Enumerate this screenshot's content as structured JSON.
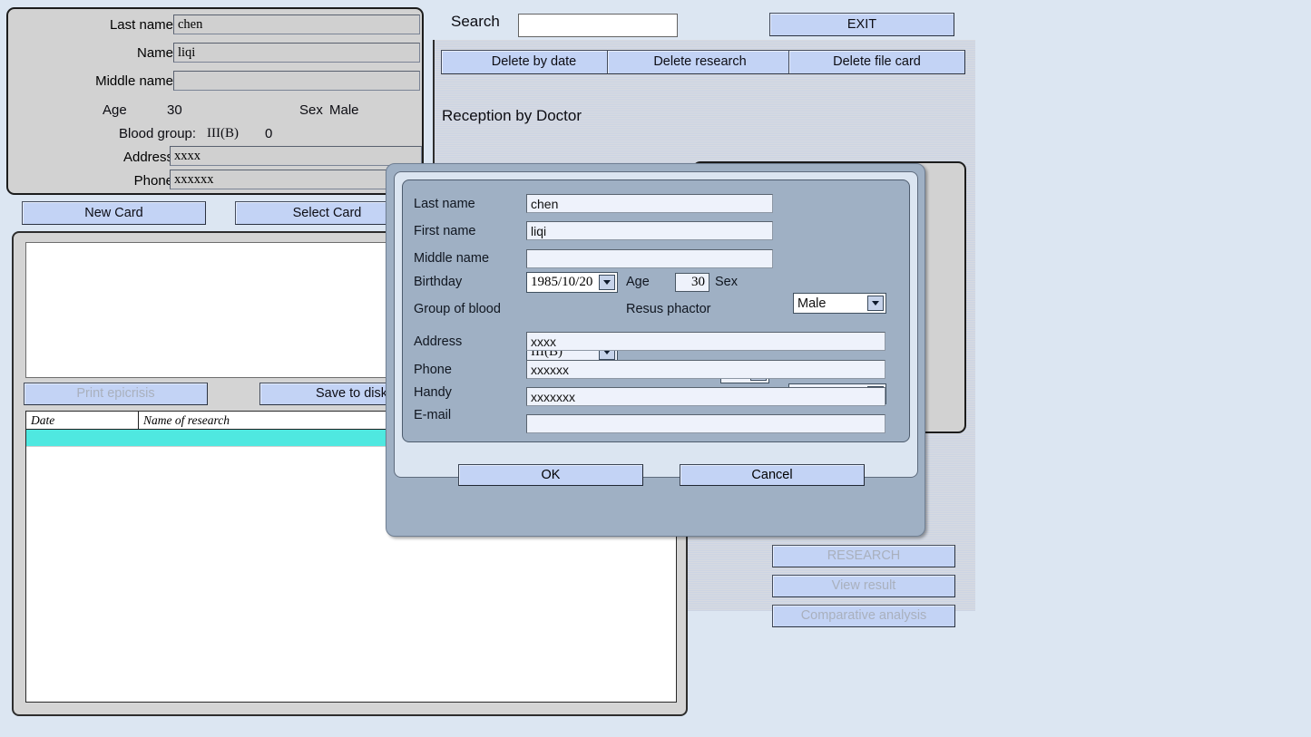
{
  "app": {
    "background_color": "#dce6f2",
    "accent_button_color": "#c3d3f5",
    "selection_color": "#4fe8e0"
  },
  "card_panel": {
    "rows": [
      {
        "label": "Last name",
        "value": "chen"
      },
      {
        "label": "Name",
        "value": "liqi"
      },
      {
        "label": "Middle name",
        "value": ""
      }
    ],
    "age_label": "Age",
    "age_value": "30",
    "sex_label": "Sex",
    "sex_value": "Male",
    "blood_group_label": "Blood group:",
    "blood_group_value": "III(B)",
    "resus_value": "0",
    "address_label": "Address",
    "address_value": "xxxx",
    "phone_label": "Phone",
    "phone_value": "xxxxxx"
  },
  "card_buttons": {
    "new_card": "New Card",
    "select_card": "Select Card"
  },
  "list_panel": {
    "print_epicrisis": "Print epicrisis",
    "save_to_disk": "Save to disk",
    "grid_headers": [
      "Date",
      "Name of research"
    ],
    "grid_rows": [
      {
        "date": "",
        "name": ""
      }
    ]
  },
  "toolbar": {
    "search_label": "Search",
    "search_value": "",
    "search_placeholder": "",
    "exit": "EXIT",
    "delete_by_date": "Delete by date",
    "delete_research": "Delete research",
    "delete_file_card": "Delete file card"
  },
  "right_panel": {
    "section_title": "Reception by Doctor",
    "research_button": "RESEARCH",
    "view_result_button": "View result",
    "comparative_analysis_button": "Comparative analysis"
  },
  "dialog": {
    "fields": {
      "last_name_label": "Last name",
      "last_name_value": "chen",
      "first_name_label": "First name",
      "first_name_value": "liqi",
      "middle_name_label": "Middle name",
      "middle_name_value": "",
      "birthday_label": "Birthday",
      "birthday_value": "1985/10/20",
      "age_label": "Age",
      "age_value": "30",
      "sex_label": "Sex",
      "sex_value": "Male",
      "group_of_blood_label": "Group of blood",
      "group_of_blood_value": "III(B)",
      "resus_phactor_label": "Resus phactor",
      "resus_phactor_value": "",
      "resus_extra_value": "",
      "address_label": "Address",
      "address_value": "xxxx",
      "phone_label": "Phone",
      "phone_value": "xxxxxx",
      "handy_label": "Handy",
      "handy_value": "xxxxxxx",
      "email_label": "E-mail",
      "email_value": ""
    },
    "ok": "OK",
    "cancel": "Cancel"
  }
}
